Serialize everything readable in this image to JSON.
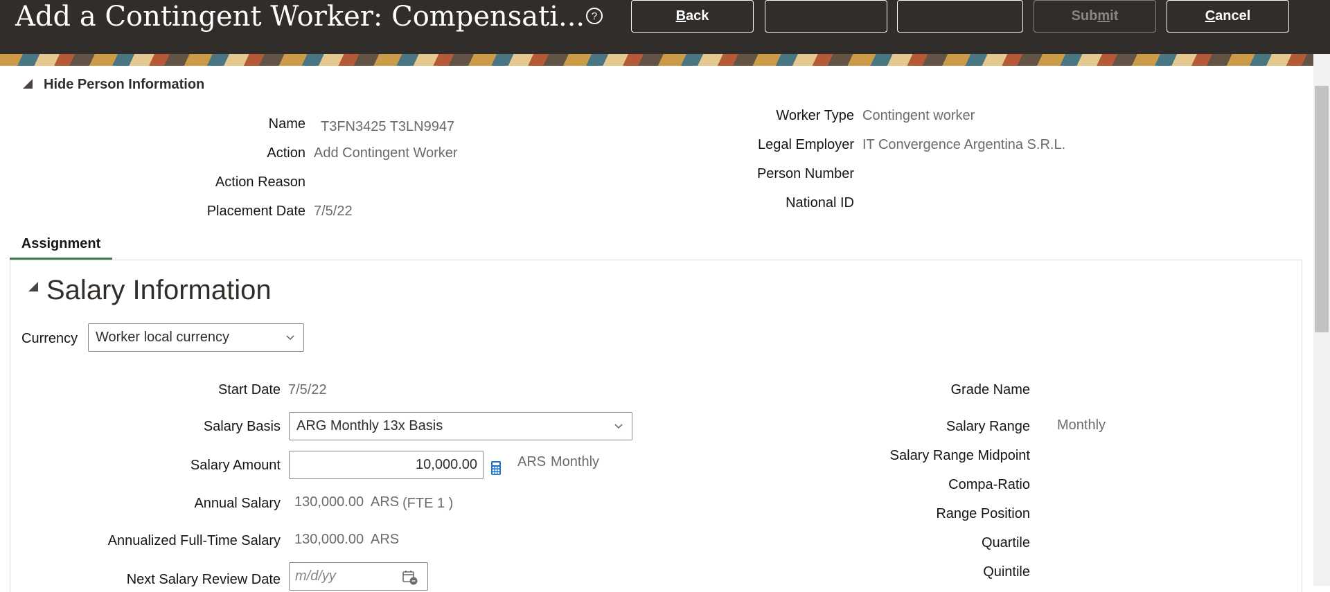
{
  "header": {
    "title": "Add a Contingent Worker: Compensati...",
    "buttons": {
      "back": {
        "pre": "",
        "ul": "B",
        "post": "ack"
      },
      "blank1": "",
      "blank2": "",
      "submit": {
        "pre": "Sub",
        "ul": "m",
        "post": "it"
      },
      "cancel": {
        "pre": "",
        "ul": "C",
        "post": "ancel"
      }
    }
  },
  "person_info": {
    "toggle_label": "Hide Person Information",
    "left": [
      {
        "label": "Name",
        "value": "T3FN3425 T3LN9947"
      },
      {
        "label": "Action",
        "value": "Add Contingent Worker"
      },
      {
        "label": "Action Reason",
        "value": ""
      },
      {
        "label": "Placement Date",
        "value": "7/5/22"
      }
    ],
    "right": [
      {
        "label": "Worker Type",
        "value": "Contingent worker"
      },
      {
        "label": "Legal Employer",
        "value": "IT Convergence Argentina S.R.L."
      },
      {
        "label": "Person Number",
        "value": ""
      },
      {
        "label": "National ID",
        "value": ""
      }
    ]
  },
  "tabs": [
    {
      "label": "Assignment",
      "selected": true
    }
  ],
  "salary": {
    "section_title": "Salary Information",
    "currency_label": "Currency",
    "currency_value": "Worker local currency",
    "start_date_label": "Start Date",
    "start_date_value": "7/5/22",
    "salary_basis_label": "Salary Basis",
    "salary_basis_value": "ARG Monthly 13x Basis",
    "salary_amount_label": "Salary Amount",
    "salary_amount_value": "10,000.00",
    "salary_amount_currency": "ARS",
    "salary_amount_frequency": "Monthly",
    "annual_salary_label": "Annual Salary",
    "annual_salary_value": "130,000.00",
    "annual_salary_currency": "ARS",
    "annual_salary_fte": "(FTE 1 )",
    "annualized_label": "Annualized Full-Time Salary",
    "annualized_value": "130,000.00",
    "annualized_currency": "ARS",
    "next_review_label": "Next Salary Review Date",
    "next_review_placeholder": "m/d/yy",
    "grade_name_label": "Grade Name",
    "salary_range_label": "Salary Range",
    "salary_range_value": "Monthly",
    "midpoint_label": "Salary Range Midpoint",
    "compa_ratio_label": "Compa-Ratio",
    "range_position_label": "Range Position",
    "quartile_label": "Quartile",
    "quintile_label": "Quintile"
  },
  "colors": {
    "header_bg": "#312d2a",
    "tab_accent": "#3b7d4f",
    "calculator_icon": "#1a73c9"
  },
  "icons": [
    "help-icon",
    "disclosure-triangle-icon",
    "chevron-down-icon",
    "calculator-icon",
    "calendar-icon"
  ]
}
